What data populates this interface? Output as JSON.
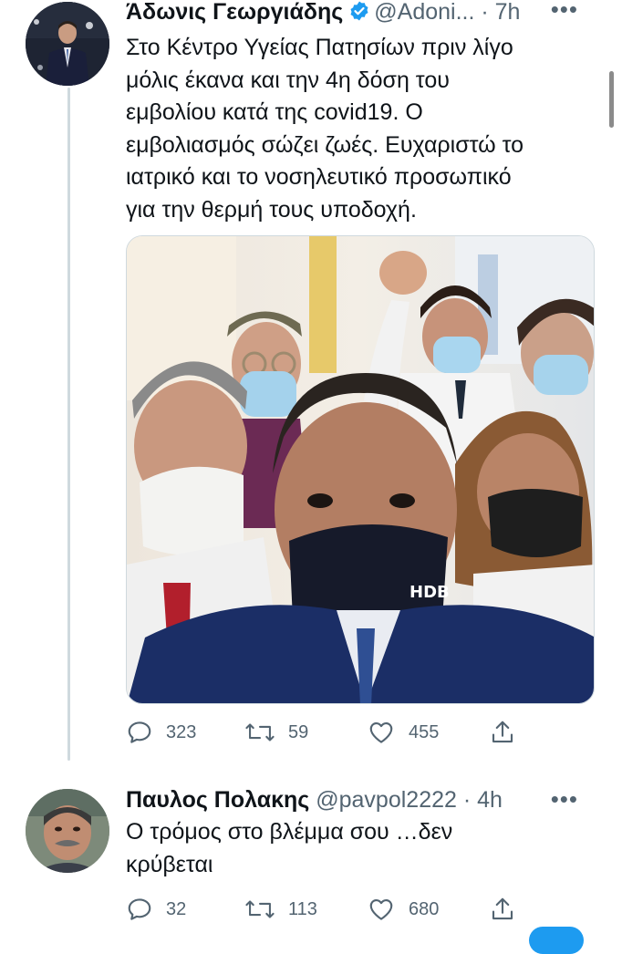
{
  "tweets": [
    {
      "author_name": "Άδωνις Γεωργιάδης",
      "handle_time": "@Adoni... · 7h",
      "more_label": "•••",
      "text": "Στο Κέντρο Υγείας Πατησίων πριν λίγο\nμόλις έκανα και την 4η δόση του\nεμβολίου κατά της covid19. Ο\nεμβολιασμός σώζει ζωές. Ευχαριστώ το\nιατρικό και το νοσηλευτικό προσωπικό\nγια την θερμή τους υποδοχή.",
      "mask_logo": "HDB",
      "stats": {
        "replies": "323",
        "retweets": "59",
        "likes": "455"
      }
    },
    {
      "author_name": "Παυλος Πολακης",
      "handle_time": "@pavpol2222 · 4h",
      "more_label": "•••",
      "text": "Ο τρόμος στο βλέμμα σου …δεν\nκρύβεται",
      "stats": {
        "replies": "32",
        "retweets": "113",
        "likes": "680"
      }
    }
  ],
  "colors": {
    "accent": "#1d9bf0",
    "secondary_text": "#536471",
    "primary_text": "#0f1419",
    "divider": "#cfd9de"
  },
  "icons": [
    "verified-badge-icon",
    "reply-icon",
    "retweet-icon",
    "like-icon",
    "share-icon",
    "more-icon"
  ]
}
